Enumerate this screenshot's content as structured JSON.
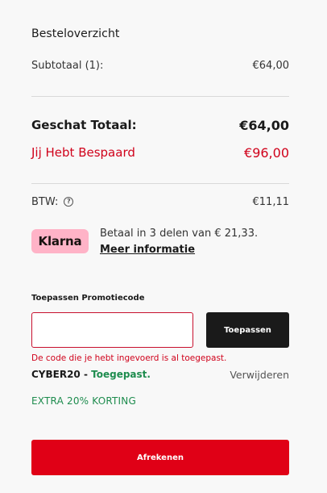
{
  "summary": {
    "title": "Besteloverzicht",
    "subtotal_label": "Subtotaal (1):",
    "subtotal_value": "€64,00",
    "total_label": "Geschat Totaal:",
    "total_value": "€64,00",
    "saved_label": "Jij Hebt Bespaard",
    "saved_value": "€96,00",
    "vat_label": "BTW:",
    "vat_info_icon": "?",
    "vat_value": "€11,11"
  },
  "klarna": {
    "logo_text": "Klarna",
    "text": "Betaal in 3 delen van € 21,33.",
    "link": "Meer informatie"
  },
  "promo": {
    "label": "Toepassen Promotiecode",
    "input_value": "",
    "input_placeholder": "",
    "button": "Toepassen",
    "error": "De code die je hebt ingevoerd is al toegepast.",
    "applied_code": "CYBER20",
    "applied_separator": " - ",
    "applied_status": "Toegepast.",
    "remove": "Verwijderen",
    "discount_text": "EXTRA 20% KORTING"
  },
  "checkout": {
    "button": "Afrekenen"
  },
  "colors": {
    "accent_red": "#e00016",
    "error_red": "#d0021b",
    "success_green": "#1e8c4e",
    "klarna_pink": "#ffb3c7",
    "dark_button": "#1a1a1a"
  }
}
